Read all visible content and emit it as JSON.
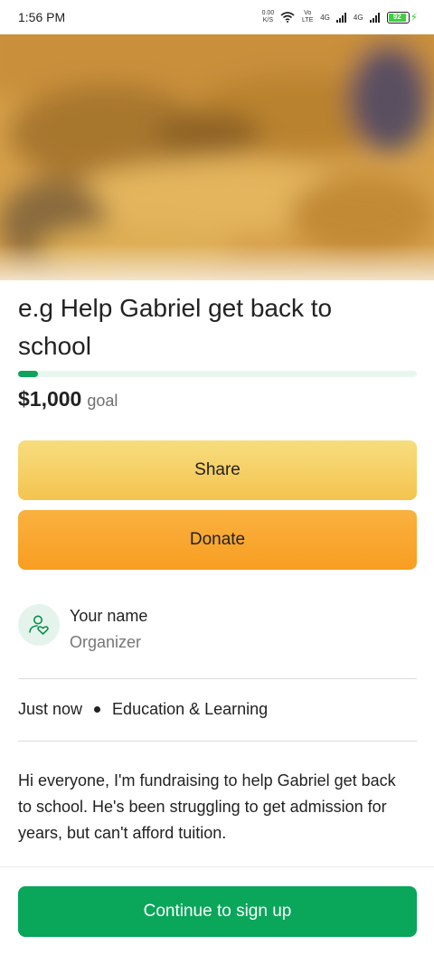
{
  "status_bar": {
    "time": "1:56 PM",
    "net_speed_value": "0.00",
    "net_speed_unit": "K/S",
    "volte": "Vo LTE",
    "signal1": "4G",
    "signal2": "4G",
    "battery": "92"
  },
  "fundraiser": {
    "title": "e.g Help Gabriel get back to school",
    "progress_fraction": 0.05,
    "goal_amount": "$1,000",
    "goal_label": "goal"
  },
  "actions": {
    "share_label": "Share",
    "donate_label": "Donate"
  },
  "organizer": {
    "name": "Your name",
    "role": "Organizer",
    "icon": "user-heart-icon"
  },
  "meta": {
    "time": "Just now",
    "category": "Education & Learning"
  },
  "story": "Hi everyone, I'm fundraising to help Gabriel get back to school. He's been struggling to get admission for years, but can't afford tuition.",
  "footer": {
    "continue_label": "Continue to sign up"
  },
  "colors": {
    "brand_green": "#0aa65a",
    "share_yellow": "#f5cf63",
    "donate_orange": "#f9a62e"
  }
}
